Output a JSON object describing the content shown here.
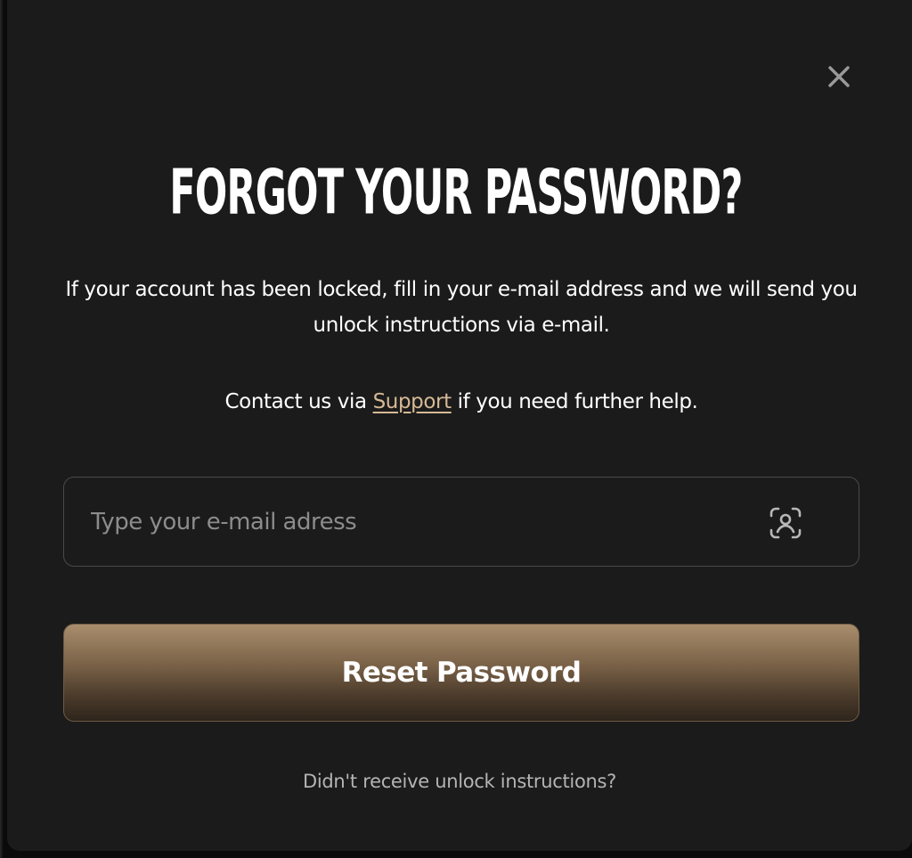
{
  "dialog": {
    "title": "FORGOT YOUR PASSWORD?",
    "description": "If your account has been locked, fill in your e-mail address and we will send you unlock instructions via e-mail.",
    "contact_prefix": "Contact us via ",
    "contact_link": "Support",
    "contact_suffix": " if you need further help.",
    "close_icon": "close-icon"
  },
  "email_input": {
    "placeholder": "Type your e-mail adress",
    "value": "",
    "icon": "user-scan-icon"
  },
  "reset_button": {
    "label": "Reset Password"
  },
  "resend_link": {
    "label": "Didn't receive unlock instructions?"
  },
  "colors": {
    "background": "#1b1b1b",
    "accent_link": "#d6b995",
    "button_gradient_top": "#a98e6d",
    "button_gradient_bottom": "#2e251c"
  }
}
